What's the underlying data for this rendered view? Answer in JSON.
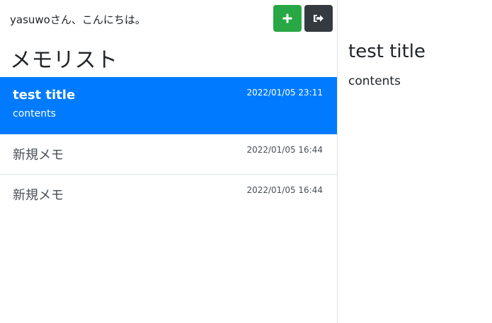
{
  "header": {
    "greeting": "yasuwoさん、こんにちは。",
    "add_icon": "plus-icon",
    "logout_icon": "sign-out-icon"
  },
  "list": {
    "title": "メモリスト",
    "items": [
      {
        "title": "test title",
        "date": "2022/01/05 23:11",
        "body": "contents",
        "active": true
      },
      {
        "title": "新規メモ",
        "date": "2022/01/05 16:44",
        "active": false
      },
      {
        "title": "新規メモ",
        "date": "2022/01/05 16:44",
        "active": false
      }
    ]
  },
  "detail": {
    "title": "test title",
    "body": "contents"
  },
  "colors": {
    "active_bg": "#007bff",
    "add_button": "#28a745",
    "logout_button": "#343a40",
    "divider": "#dee2e6"
  }
}
